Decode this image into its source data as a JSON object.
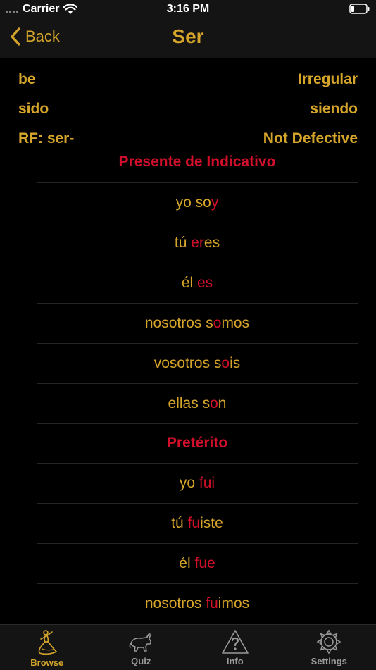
{
  "status": {
    "carrier": "Carrier",
    "time": "3:16 PM"
  },
  "nav": {
    "back_label": "Back",
    "title": "Ser"
  },
  "info": {
    "infinitive_meaning": "be",
    "regularity": "Irregular",
    "participle": "sido",
    "gerund": "siendo",
    "root_form": "RF:  ser-",
    "defectiveness": "Not Defective"
  },
  "sections": [
    {
      "title": "Presente de Indicativo",
      "rows": [
        {
          "plain": "yo so",
          "highlight": "y",
          "rest": ""
        },
        {
          "plain": "tú ",
          "highlight": "er",
          "rest": "es"
        },
        {
          "plain": "él ",
          "highlight": "es",
          "rest": ""
        },
        {
          "plain": "nosotros s",
          "highlight": "o",
          "rest": "mos"
        },
        {
          "plain": "vosotros s",
          "highlight": "o",
          "rest": "is"
        },
        {
          "plain": "ellas s",
          "highlight": "o",
          "rest": "n"
        }
      ]
    },
    {
      "title": "Pretérito",
      "rows": [
        {
          "plain": "yo ",
          "highlight": "fui",
          "rest": ""
        },
        {
          "plain": "tú ",
          "highlight": "fu",
          "rest": "iste"
        },
        {
          "plain": "él ",
          "highlight": "fue",
          "rest": ""
        },
        {
          "plain": "nosotros ",
          "highlight": "fu",
          "rest": "imos"
        }
      ]
    }
  ],
  "tabs": [
    {
      "label": "Browse",
      "icon": "flamenco-dancer-icon",
      "active": true
    },
    {
      "label": "Quiz",
      "icon": "bull-icon",
      "active": false
    },
    {
      "label": "Info",
      "icon": "question-triangle-icon",
      "active": false
    },
    {
      "label": "Settings",
      "icon": "gear-icon",
      "active": false
    }
  ],
  "colors": {
    "accent": "#d4a52a",
    "highlight": "#d0102a",
    "background": "#000000"
  }
}
